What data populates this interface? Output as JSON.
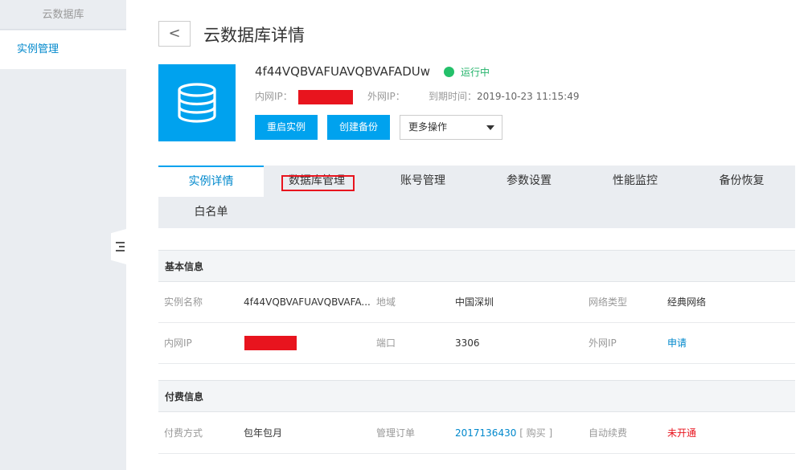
{
  "sidebar": {
    "title": "云数据库",
    "items": [
      {
        "label": "实例管理"
      }
    ]
  },
  "header": {
    "back_icon": "<",
    "title": "云数据库详情"
  },
  "instance": {
    "id": "4f44VQBVAFUAVQBVAFADUw",
    "status": "运行中",
    "status_color": "#24c06a",
    "inner_ip_label": "内网IP：",
    "outer_ip_label": "外网IP：",
    "expire_label": "到期时间：",
    "expire_value": "2019-10-23 11:15:49"
  },
  "actions": {
    "restart": "重启实例",
    "backup": "创建备份",
    "more": "更多操作"
  },
  "tabs": [
    {
      "label": "实例详情"
    },
    {
      "label": "数据库管理"
    },
    {
      "label": "账号管理"
    },
    {
      "label": "参数设置"
    },
    {
      "label": "性能监控"
    },
    {
      "label": "备份恢复"
    },
    {
      "label": "白名单"
    }
  ],
  "basic": {
    "header": "基本信息",
    "rows": [
      [
        {
          "label": "实例名称",
          "value": "4f44VQBVAFUAVQBVAFA..."
        },
        {
          "label": "地域",
          "value": "中国深圳"
        },
        {
          "label": "网络类型",
          "value": "经典网络"
        }
      ],
      [
        {
          "label": "内网IP",
          "value": ""
        },
        {
          "label": "端口",
          "value": "3306"
        },
        {
          "label": "外网IP",
          "value": "申请"
        }
      ]
    ]
  },
  "billing": {
    "header": "付费信息",
    "pay_label": "付费方式",
    "pay_value": "包年包月",
    "order_label": "管理订单",
    "order_id": "2017136430",
    "order_action": "[ 购买 ]",
    "renew_label": "自动续费",
    "renew_value": "未开通"
  },
  "colors": {
    "accent": "#00a2ee",
    "link": "#0088cc",
    "danger": "#e8141e"
  }
}
